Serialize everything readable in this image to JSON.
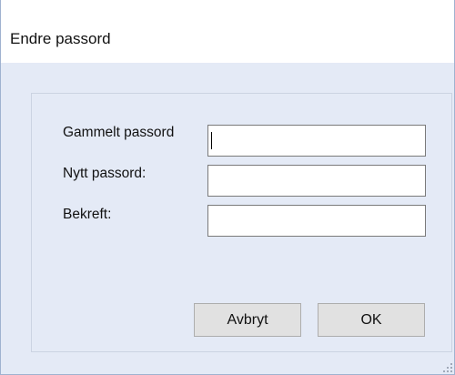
{
  "window": {
    "title": "Endre passord"
  },
  "form": {
    "old_password_label": "Gammelt passord",
    "new_password_label": "Nytt passord:",
    "confirm_label": "Bekreft:",
    "old_password_value": "",
    "new_password_value": "",
    "confirm_value": ""
  },
  "buttons": {
    "cancel_label": "Avbryt",
    "ok_label": "OK"
  },
  "icons": {
    "resize_grip": "resize-grip-icon"
  },
  "colors": {
    "dialog_background": "#e4eaf6",
    "titlebar_background": "#ffffff",
    "button_background": "#e1e1e1"
  }
}
